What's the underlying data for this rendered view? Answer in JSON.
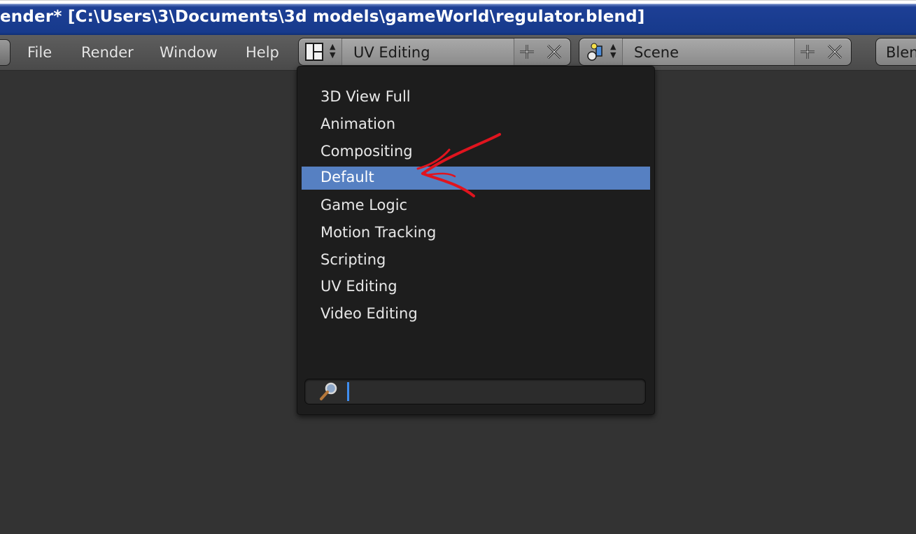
{
  "window": {
    "title": "ender* [C:\\Users\\3\\Documents\\3d models\\gameWorld\\regulator.blend]"
  },
  "menubar": {
    "items": [
      {
        "label": "File"
      },
      {
        "label": "Render"
      },
      {
        "label": "Window"
      },
      {
        "label": "Help"
      }
    ],
    "layout_selector": {
      "value": "UV Editing",
      "icon": "screen-layout-icon"
    },
    "scene_selector": {
      "value": "Scene",
      "icon": "scene-icon"
    },
    "render_engine": {
      "label": "Blen"
    }
  },
  "dropdown": {
    "items": [
      {
        "label": "3D View Full",
        "active": false
      },
      {
        "label": "Animation",
        "active": false
      },
      {
        "label": "Compositing",
        "active": false
      },
      {
        "label": "Default",
        "active": true
      },
      {
        "label": "Game Logic",
        "active": false
      },
      {
        "label": "Motion Tracking",
        "active": false
      },
      {
        "label": "Scripting",
        "active": false
      },
      {
        "label": "UV Editing",
        "active": false
      },
      {
        "label": "Video Editing",
        "active": false
      }
    ],
    "search": {
      "value": "",
      "icon": "magnifier-icon"
    }
  },
  "colors": {
    "highlight": "#5680c2",
    "annotation": "#e0141e",
    "titlebar": "#1d3f95",
    "text_cursor": "#3f8ef0"
  }
}
